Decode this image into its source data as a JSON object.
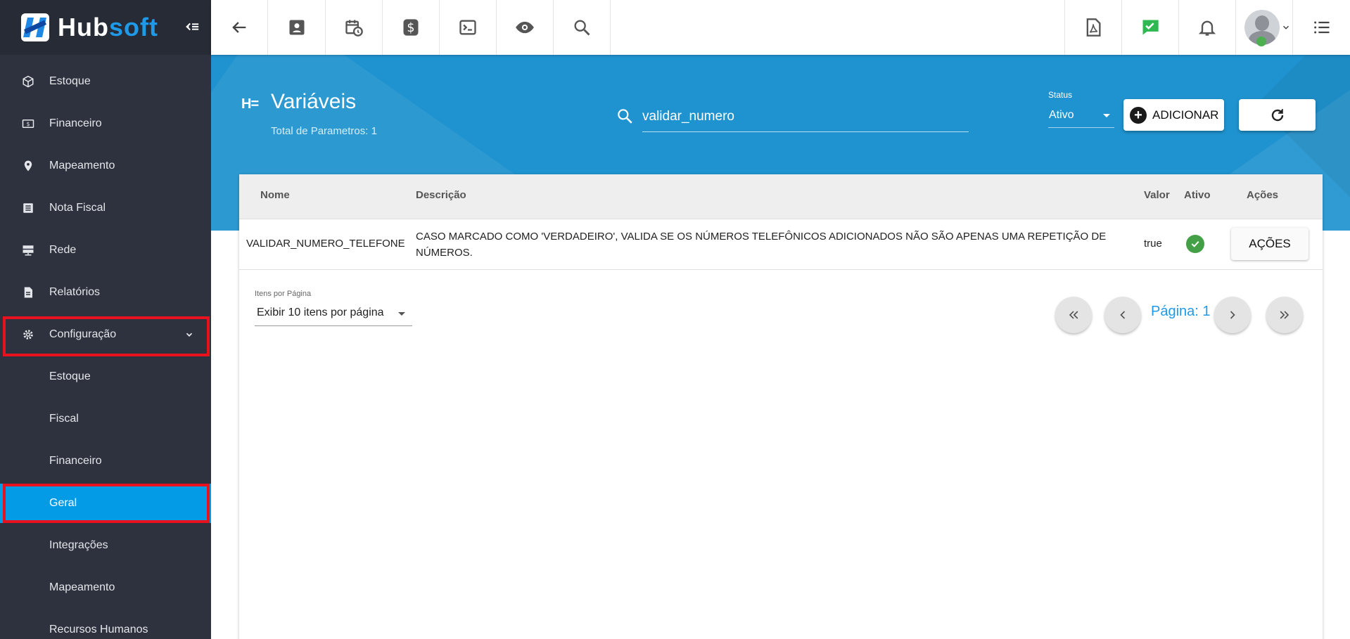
{
  "brand": {
    "name_part1": "Hub",
    "name_part2": "soft"
  },
  "sidebar": {
    "items": [
      {
        "label": "Estoque",
        "icon": "box-icon"
      },
      {
        "label": "Financeiro",
        "icon": "money-icon"
      },
      {
        "label": "Mapeamento",
        "icon": "map-pin-icon"
      },
      {
        "label": "Nota Fiscal",
        "icon": "document-list-icon"
      },
      {
        "label": "Rede",
        "icon": "server-icon"
      },
      {
        "label": "Relatórios",
        "icon": "report-icon"
      },
      {
        "label": "Configuração",
        "icon": "gear-icon",
        "expanded": true
      }
    ],
    "subitems": [
      {
        "label": "Estoque"
      },
      {
        "label": "Fiscal"
      },
      {
        "label": "Financeiro"
      },
      {
        "label": "Geral",
        "active": true
      },
      {
        "label": "Integrações"
      },
      {
        "label": "Mapeamento"
      },
      {
        "label": "Recursos Humanos"
      }
    ]
  },
  "topbar": {
    "left_icons": [
      "back-arrow-icon",
      "contact-card-icon",
      "calendar-clock-icon",
      "dollar-icon",
      "terminal-icon",
      "eye-icon",
      "search-icon"
    ],
    "right_icons": [
      "pdf-icon",
      "chat-check-icon",
      "bell-icon",
      "avatar",
      "list-menu-icon"
    ]
  },
  "page": {
    "icon_text": "H=",
    "title": "Variáveis",
    "subtitle": "Total de Parametros: 1"
  },
  "search": {
    "value": "validar_numero"
  },
  "status_filter": {
    "label": "Status",
    "value": "Ativo"
  },
  "actions": {
    "add_label": "ADICIONAR"
  },
  "table": {
    "columns": [
      "Nome",
      "Descrição",
      "Valor",
      "Ativo",
      "Ações"
    ],
    "rows": [
      {
        "nome": "VALIDAR_NUMERO_TELEFONE",
        "descricao": "CASO MARCADO COMO 'VERDADEIRO', VALIDA SE OS NÚMEROS TELEFÔNICOS ADICIONADOS NÃO SÃO APENAS UMA REPETIÇÃO DE NÚMEROS.",
        "valor": "true",
        "ativo": true,
        "acoes_label": "AÇÕES"
      }
    ]
  },
  "pagination": {
    "per_page_label": "Itens por Página",
    "per_page_value": "Exibir 10 itens por página",
    "page_label": "Página: 1"
  },
  "colors": {
    "sidebar_bg": "#2d323e",
    "accent": "#039be5",
    "header_band": "#1f93cf",
    "highlight": "#e8121f",
    "success": "#43a047"
  }
}
